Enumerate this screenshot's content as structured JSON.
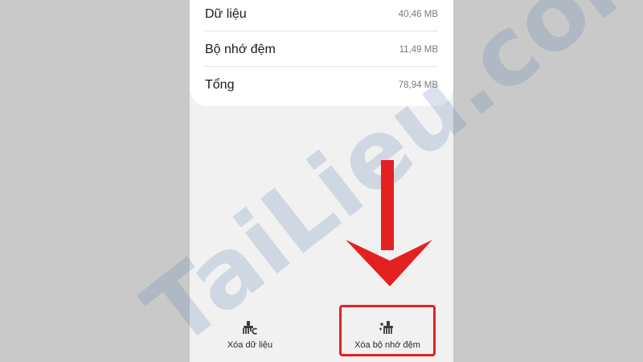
{
  "storage": {
    "rows": [
      {
        "label": "Dữ liệu",
        "value": "40,46 MB"
      },
      {
        "label": "Bộ nhớ đệm",
        "value": "11,49 MB"
      },
      {
        "label": "Tổng",
        "value": "78,94 MB"
      }
    ]
  },
  "actions": {
    "clear_data": {
      "label": "Xóa dữ liệu",
      "icon": "brush-clear-data-icon"
    },
    "clear_cache": {
      "label": "Xóa bộ nhớ đệm",
      "icon": "brush-clear-cache-icon"
    }
  },
  "annotation": {
    "arrow_color": "#e32121",
    "box_color": "#e32121"
  },
  "watermark": {
    "text": "TaiLieu.com"
  }
}
